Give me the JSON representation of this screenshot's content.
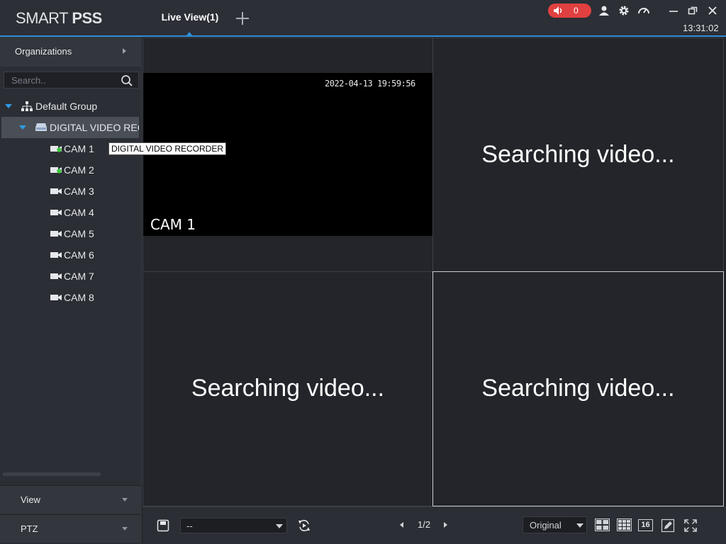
{
  "app": {
    "logo_light": "SMART ",
    "logo_bold": "PSS",
    "clock": "13:31:02"
  },
  "tabs": [
    {
      "label": "Live View(1)",
      "active": true
    }
  ],
  "header": {
    "alarm_count": "0",
    "icons": [
      "speaker-icon",
      "user-icon",
      "gear-icon",
      "gauge-icon",
      "minimize-icon",
      "restore-icon",
      "close-icon"
    ]
  },
  "sidebar": {
    "organizations_label": "Organizations",
    "search_placeholder": "Search..",
    "tree": {
      "group_label": "Default Group",
      "device_label": "DIGITAL VIDEO REC",
      "cameras": [
        {
          "label": "CAM 1",
          "online": true
        },
        {
          "label": "CAM 2",
          "online": true
        },
        {
          "label": "CAM 3",
          "online": false
        },
        {
          "label": "CAM 4",
          "online": false
        },
        {
          "label": "CAM 5",
          "online": false
        },
        {
          "label": "CAM 6",
          "online": false
        },
        {
          "label": "CAM 7",
          "online": false
        },
        {
          "label": "CAM 8",
          "online": false
        }
      ]
    },
    "tooltip": "DIGITAL VIDEO RECORDER",
    "view_label": "View",
    "ptz_label": "PTZ"
  },
  "grid": {
    "cell1": {
      "timestamp": "2022-04-13 19:59:56",
      "camera_name": "CAM 1"
    },
    "cell2_text": "Searching video...",
    "cell3_text": "Searching video...",
    "cell4_text": "Searching video..."
  },
  "toolbar": {
    "view_select_value": "--",
    "page": "1/2",
    "ratio_value": "Original",
    "split16_label": "16"
  },
  "colors": {
    "accent": "#2f8fd8",
    "alarm": "#e0403f",
    "online": "#3cc83c",
    "background": "#1f2126"
  }
}
